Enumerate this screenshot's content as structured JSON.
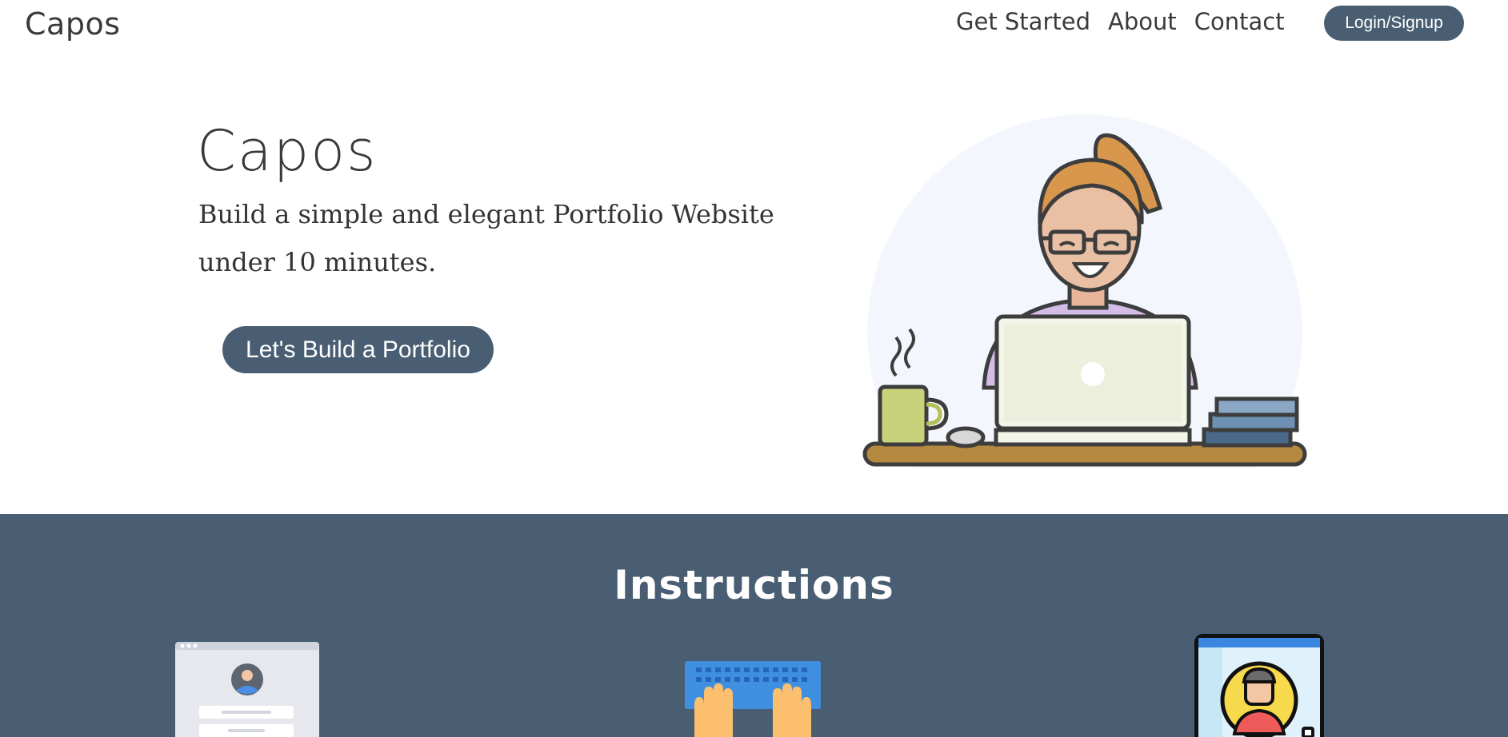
{
  "nav": {
    "brand": "Capos",
    "links": [
      "Get Started",
      "About",
      "Contact"
    ],
    "login_label": "Login/Signup"
  },
  "hero": {
    "title": "Capos",
    "subtitle": "Build a simple and elegant Portfolio Website under 10 minutes.",
    "cta_label": "Let's Build a Portfolio",
    "illustration": "woman-with-laptop-illustration"
  },
  "instructions": {
    "title": "Instructions",
    "steps": [
      {
        "icon": "signup-form-icon"
      },
      {
        "icon": "typing-keyboard-icon"
      },
      {
        "icon": "profile-card-icon"
      }
    ]
  },
  "colors": {
    "primary": "#495e72",
    "text": "#3a3a3a",
    "background": "#ffffff"
  }
}
